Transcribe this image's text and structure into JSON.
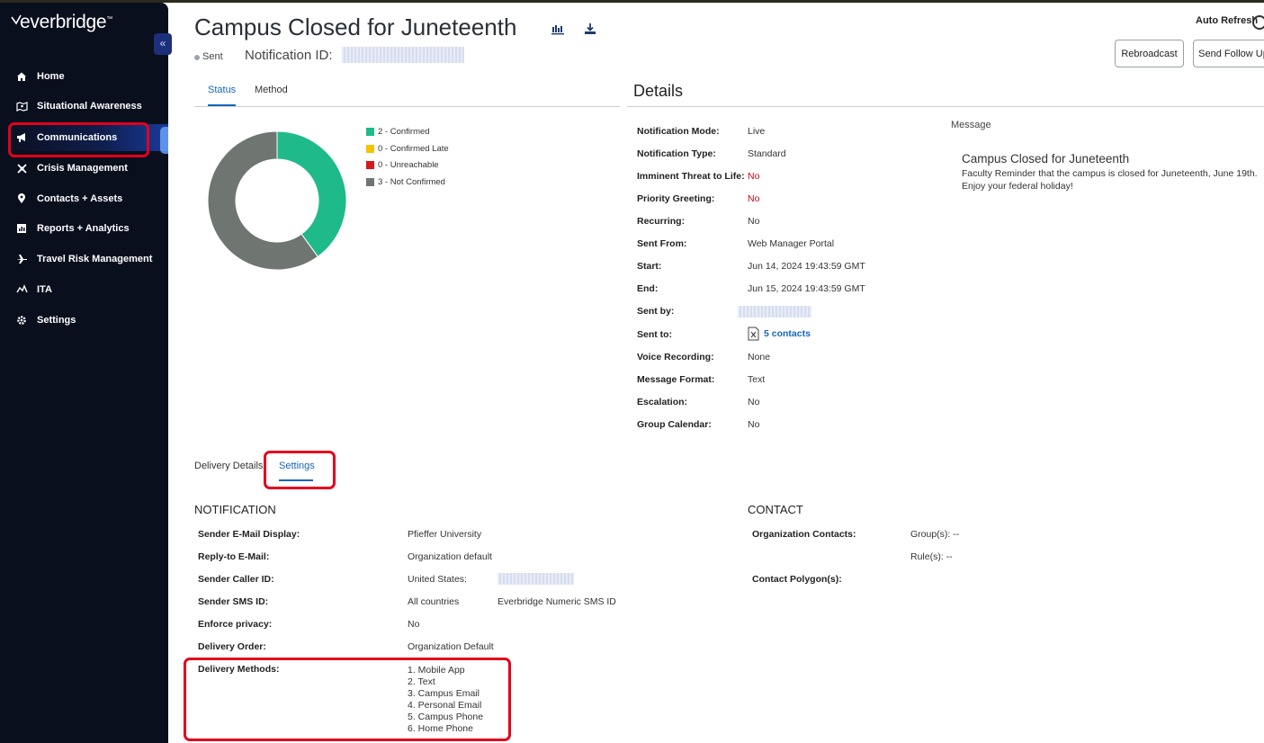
{
  "brand": {
    "logo_text": "everbridge",
    "accent": "#1565c0",
    "alert_red": "#e3001b"
  },
  "sidebar": {
    "collapse_icon": "double-chevron-left-icon",
    "items": [
      {
        "label": "Home",
        "icon": "home-icon"
      },
      {
        "label": "Situational Awareness",
        "icon": "map-icon"
      },
      {
        "label": "Communications",
        "icon": "megaphone-icon",
        "active": true
      },
      {
        "label": "Crisis Management",
        "icon": "crisis-icon"
      },
      {
        "label": "Contacts + Assets",
        "icon": "location-pin-icon"
      },
      {
        "label": "Reports + Analytics",
        "icon": "chart-icon"
      },
      {
        "label": "Travel Risk Management",
        "icon": "airplane-icon"
      },
      {
        "label": "ITA",
        "icon": "ita-icon"
      },
      {
        "label": "Settings",
        "icon": "gear-icon"
      }
    ]
  },
  "header": {
    "title": "Campus Closed for Juneteenth",
    "status": "Sent",
    "notification_id_label": "Notification ID:",
    "auto_refresh_label": "Auto Refresh",
    "rebroadcast_label": "Rebroadcast",
    "send_follow_up_label": "Send Follow Up"
  },
  "status_tabs": {
    "status": "Status",
    "method": "Method"
  },
  "chart_data": {
    "type": "pie",
    "donut": true,
    "categories": [
      "Confirmed",
      "Confirmed Late",
      "Unreachable",
      "Not Confirmed"
    ],
    "values": [
      2,
      0,
      0,
      3
    ],
    "colors": [
      "#1fba8a",
      "#f5c400",
      "#d71920",
      "#6f7570"
    ],
    "legend": [
      "2 - Confirmed",
      "0 - Confirmed Late",
      "0 - Unreachable",
      "3 - Not Confirmed"
    ],
    "legend_position": "right"
  },
  "details": {
    "title": "Details",
    "rows": [
      {
        "label": "Notification Mode:",
        "value": "Live"
      },
      {
        "label": "Notification Type:",
        "value": "Standard"
      },
      {
        "label": "Imminent Threat to Life:",
        "value": "No"
      },
      {
        "label": "Priority Greeting:",
        "value": "No"
      },
      {
        "label": "Recurring:",
        "value": "No"
      },
      {
        "label": "Sent From:",
        "value": "Web Manager Portal"
      },
      {
        "label": "Start:",
        "value": "Jun 14, 2024 19:43:59 GMT"
      },
      {
        "label": "End:",
        "value": "Jun 15, 2024 19:43:59 GMT"
      },
      {
        "label": "Sent by:",
        "value": ""
      },
      {
        "label": "Sent to:",
        "value": "5  contacts"
      },
      {
        "label": "Voice Recording:",
        "value": "None"
      },
      {
        "label": "Message Format:",
        "value": "Text"
      },
      {
        "label": "Escalation:",
        "value": "No"
      },
      {
        "label": "Group Calendar:",
        "value": "No"
      }
    ],
    "message_label": "Message",
    "message_title": "Campus Closed for Juneteenth",
    "message_body": "Faculty Reminder that the campus is closed for Juneteenth, June 19th. Enjoy your federal holiday!"
  },
  "lower_tabs": {
    "delivery_details": "Delivery Details",
    "settings": "Settings"
  },
  "notification_settings": {
    "heading": "NOTIFICATION",
    "sender_email_label": "Sender E-Mail Display:",
    "sender_email_value": "Pfieffer University",
    "reply_to_label": "Reply-to E-Mail:",
    "reply_to_value": "Organization default",
    "caller_id_label": "Sender Caller ID:",
    "caller_id_value": "United States:",
    "sms_id_label": "Sender SMS ID:",
    "sms_id_value": "All countries",
    "sms_id_value2": "Everbridge Numeric SMS ID",
    "privacy_label": "Enforce privacy:",
    "privacy_value": "No",
    "delivery_order_label": "Delivery Order:",
    "delivery_order_value": "Organization Default",
    "delivery_methods_label": "Delivery Methods:",
    "delivery_methods": [
      "1. Mobile App",
      "2. Text",
      "3. Campus Email",
      "4. Personal Email",
      "5. Campus Phone",
      "6. Home Phone"
    ]
  },
  "contact_settings": {
    "heading": "CONTACT",
    "org_contacts_label": "Organization Contacts:",
    "groups_value": "Group(s): --",
    "rules_value": "Rule(s): --",
    "polygon_label": "Contact Polygon(s):"
  }
}
